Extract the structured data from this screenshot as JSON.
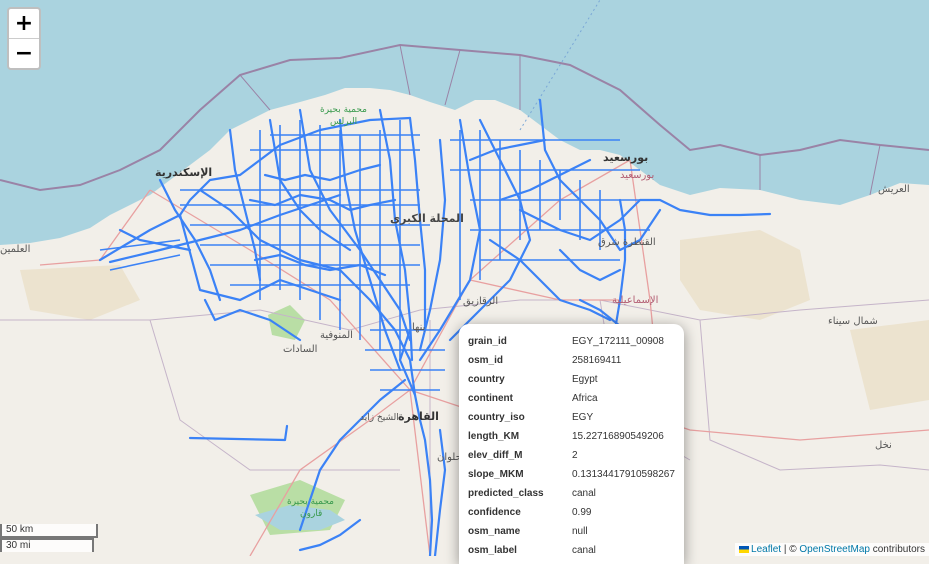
{
  "map": {
    "labels": [
      {
        "text": "بورسعيد",
        "color": "#333"
      },
      {
        "text": "بورسعيد",
        "color": "#b25c72"
      },
      {
        "text": "الإسكندرية",
        "color": "#333"
      },
      {
        "text": "العريش",
        "color": "#555"
      },
      {
        "text": "العلمين",
        "color": "#555"
      },
      {
        "text": "محمية بحيرة",
        "color": "#3a9a4e"
      },
      {
        "text": "البرلس",
        "color": "#3a9a4e"
      },
      {
        "text": "المحلة الكبرى",
        "color": "#444"
      },
      {
        "text": "الزقازيق",
        "color": "#555"
      },
      {
        "text": "القنطرة شرق",
        "color": "#555"
      },
      {
        "text": "الإسماعيلية",
        "color": "#b25c72"
      },
      {
        "text": "شمال سيناء",
        "color": "#555"
      },
      {
        "text": "المنوفية",
        "color": "#555"
      },
      {
        "text": "السادات",
        "color": "#555"
      },
      {
        "text": "بنها",
        "color": "#555"
      },
      {
        "text": "القاهرة",
        "color": "#333"
      },
      {
        "text": "الشيخ زايد",
        "color": "#555"
      },
      {
        "text": "حلوان",
        "color": "#555"
      },
      {
        "text": "نخل",
        "color": "#555"
      },
      {
        "text": "محمية بحيرة",
        "color": "#3a9a4e"
      },
      {
        "text": "قارون",
        "color": "#3a9a4e"
      }
    ],
    "colors": {
      "sea": "#aad3df",
      "land": "#f2efe9",
      "canal": "#3b82f6",
      "border": "#9a83a6",
      "desert": "#ece3cf",
      "green": "#b9dea5"
    }
  },
  "controls": {
    "zoom_in": "+",
    "zoom_out": "−"
  },
  "scale": {
    "metric": "50 km",
    "imperial": "30 mi"
  },
  "attribution": {
    "leaflet": "Leaflet",
    "separator": " | © ",
    "osm": "OpenStreetMap",
    "suffix": " contributors"
  },
  "popup": {
    "rows": [
      {
        "key": "grain_id",
        "value": "EGY_172111_00908"
      },
      {
        "key": "osm_id",
        "value": "258169411"
      },
      {
        "key": "country",
        "value": "Egypt"
      },
      {
        "key": "continent",
        "value": "Africa"
      },
      {
        "key": "country_iso",
        "value": "EGY"
      },
      {
        "key": "length_KM",
        "value": "15.22716890549206"
      },
      {
        "key": "elev_diff_M",
        "value": "2"
      },
      {
        "key": "slope_MKM",
        "value": "0.13134417910598267"
      },
      {
        "key": "predicted_class",
        "value": "canal"
      },
      {
        "key": "confidence",
        "value": "0.99"
      },
      {
        "key": "osm_name",
        "value": "null"
      },
      {
        "key": "osm_label",
        "value": "canal"
      }
    ]
  }
}
